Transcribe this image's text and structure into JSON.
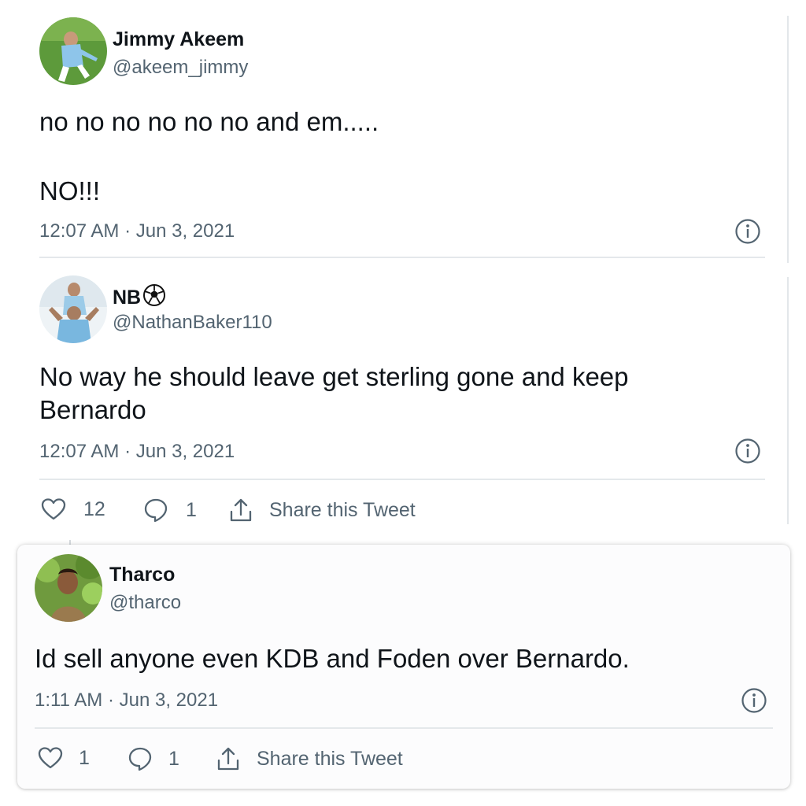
{
  "tweets": [
    {
      "name": "Jimmy Akeem",
      "handle": "@akeem_jimmy",
      "text_line1": "no no no no no no and em.....",
      "text_line2": "NO!!!",
      "timestamp": "12:07 AM · Jun 3, 2021"
    },
    {
      "name": "NB",
      "name_icon": "soccer-ball-icon",
      "handle": "@NathanBaker110",
      "text_line1": "No way he should leave get sterling gone and keep",
      "text_line2": "Bernardo",
      "timestamp": "12:07 AM · Jun 3, 2021",
      "likes": "12",
      "replies": "1",
      "share_label": "Share this Tweet"
    },
    {
      "name": "Tharco",
      "handle": "@tharco",
      "text_line1": "Id sell anyone even KDB and Foden over Bernardo.",
      "timestamp": "1:11 AM · Jun 3, 2021",
      "likes": "1",
      "replies": "1",
      "share_label": "Share this Tweet"
    }
  ],
  "colors": {
    "text": "#0f1419",
    "secondary": "#536471",
    "divider": "#e4e8eb"
  }
}
